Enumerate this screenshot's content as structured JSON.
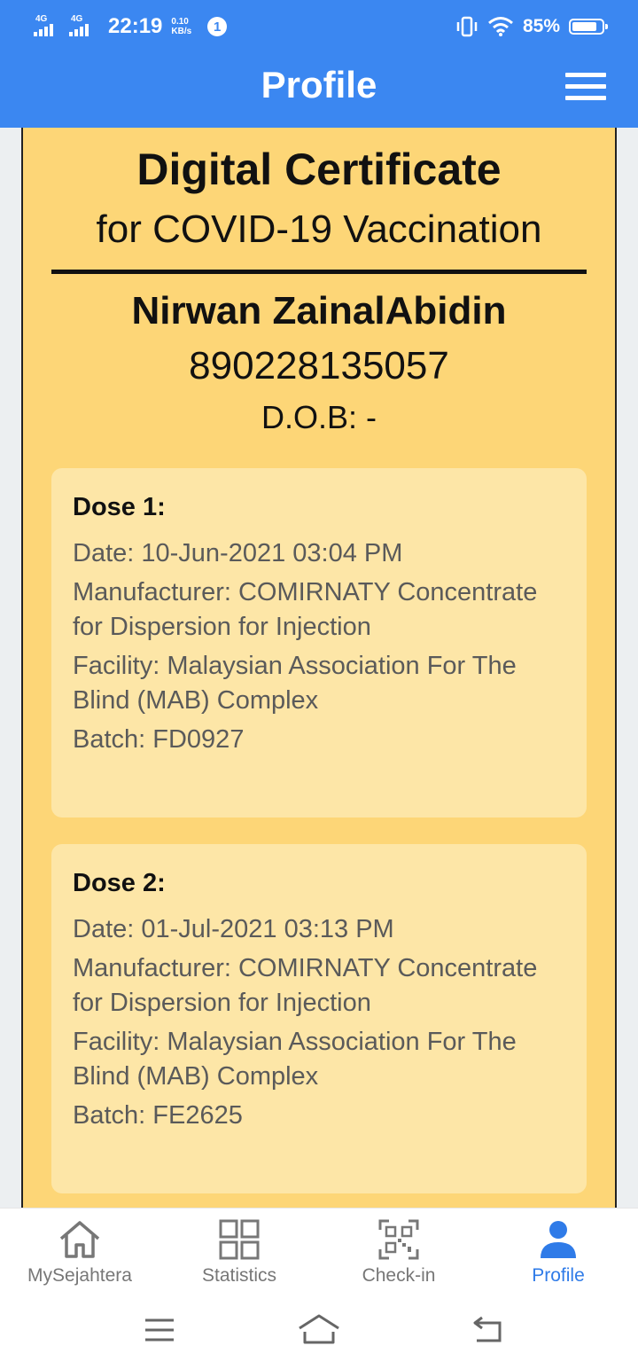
{
  "status_bar": {
    "network_1": "4G",
    "network_2": "4G",
    "time": "22:19",
    "speed_value": "0.10",
    "speed_unit": "KB/s",
    "notification_count": "1",
    "battery_percent": "85%",
    "battery_level": 0.85,
    "icons": [
      "vibrate-icon",
      "wifi-icon",
      "battery-icon"
    ]
  },
  "header": {
    "title": "Profile",
    "menu_icon": "hamburger-menu-icon"
  },
  "certificate": {
    "title": "Digital Certificate",
    "subtitle": "for COVID-19 Vaccination",
    "name": "Nirwan ZainalAbidin",
    "id_number": "890228135057",
    "dob": "D.O.B: -",
    "doses": [
      {
        "heading": "Dose 1:",
        "date": "Date: 10-Jun-2021 03:04 PM",
        "manufacturer": "Manufacturer: COMIRNATY Concentrate for Dispersion for Injection",
        "facility": "Facility: Malaysian Association For The Blind (MAB) Complex",
        "batch": "Batch: FD0927"
      },
      {
        "heading": "Dose 2:",
        "date": "Date: 01-Jul-2021 03:13 PM",
        "manufacturer": "Manufacturer: COMIRNATY Concentrate for Dispersion for Injection",
        "facility": "Facility: Malaysian Association For The Blind (MAB) Complex",
        "batch": "Batch: FE2625"
      }
    ]
  },
  "bottom_nav": {
    "items": [
      {
        "label": "MySejahtera",
        "icon": "home-icon",
        "active": false
      },
      {
        "label": "Statistics",
        "icon": "statistics-grid-icon",
        "active": false
      },
      {
        "label": "Check-in",
        "icon": "qr-code-icon",
        "active": false
      },
      {
        "label": "Profile",
        "icon": "user-icon",
        "active": true
      }
    ]
  },
  "system_nav": {
    "icons": [
      "recent-apps-icon",
      "home-outline-icon",
      "back-icon"
    ]
  },
  "colors": {
    "app_bar": "#3b87f1",
    "certificate_bg": "#fdd677",
    "dose_card_bg": "#fde6a7",
    "nav_active": "#2f7be8",
    "nav_inactive": "#777777"
  }
}
